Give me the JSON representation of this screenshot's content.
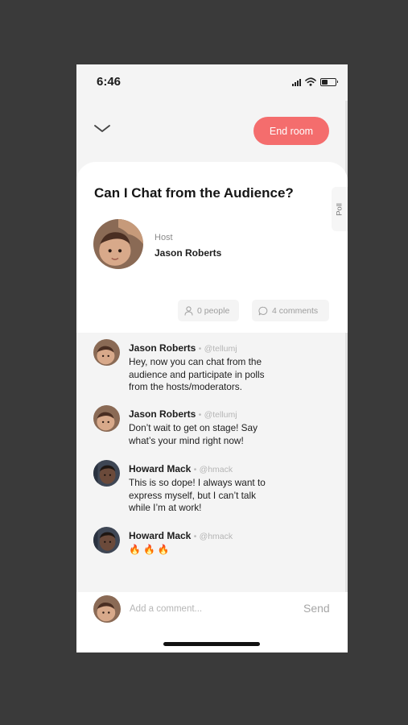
{
  "status_bar": {
    "time": "6:46"
  },
  "header": {
    "end_room_label": "End room"
  },
  "room": {
    "title": "Can I Chat from the Audience?",
    "poll_label": "Poll",
    "host_role": "Host",
    "host_name": "Jason Roberts",
    "people_count": "0 people",
    "comments_count": "4 comments"
  },
  "comments": [
    {
      "name": "Jason Roberts",
      "separator": "•",
      "handle": "@tellumj",
      "lines": [
        "Hey, now you can chat from the",
        "audience and participate in polls",
        "from the hosts/moderators."
      ]
    },
    {
      "name": "Jason Roberts",
      "separator": "•",
      "handle": "@tellumj",
      "lines": [
        "Don’t wait to get on stage! Say",
        "what’s your mind right now!"
      ]
    },
    {
      "name": "Howard Mack",
      "separator": "•",
      "handle": "@hmack",
      "lines": [
        "This is so dope! I always want to",
        "express myself, but I can’t talk",
        "while I’m at work!"
      ]
    },
    {
      "name": "Howard Mack",
      "separator": "•",
      "handle": "@hmack",
      "lines": [
        "🔥 🔥 🔥"
      ]
    }
  ],
  "compose": {
    "placeholder": "Add a comment...",
    "send_label": "Send"
  },
  "icons": {
    "collapse": "chevron-down-icon",
    "people": "person-icon",
    "comments": "chat-bubble-icon",
    "signal": "cellular-signal-icon",
    "wifi": "wifi-icon",
    "battery": "battery-icon"
  },
  "colors": {
    "accent": "#f46d6d",
    "background": "#f4f4f4",
    "card": "#ffffff",
    "frame": "#3a3a3a"
  }
}
